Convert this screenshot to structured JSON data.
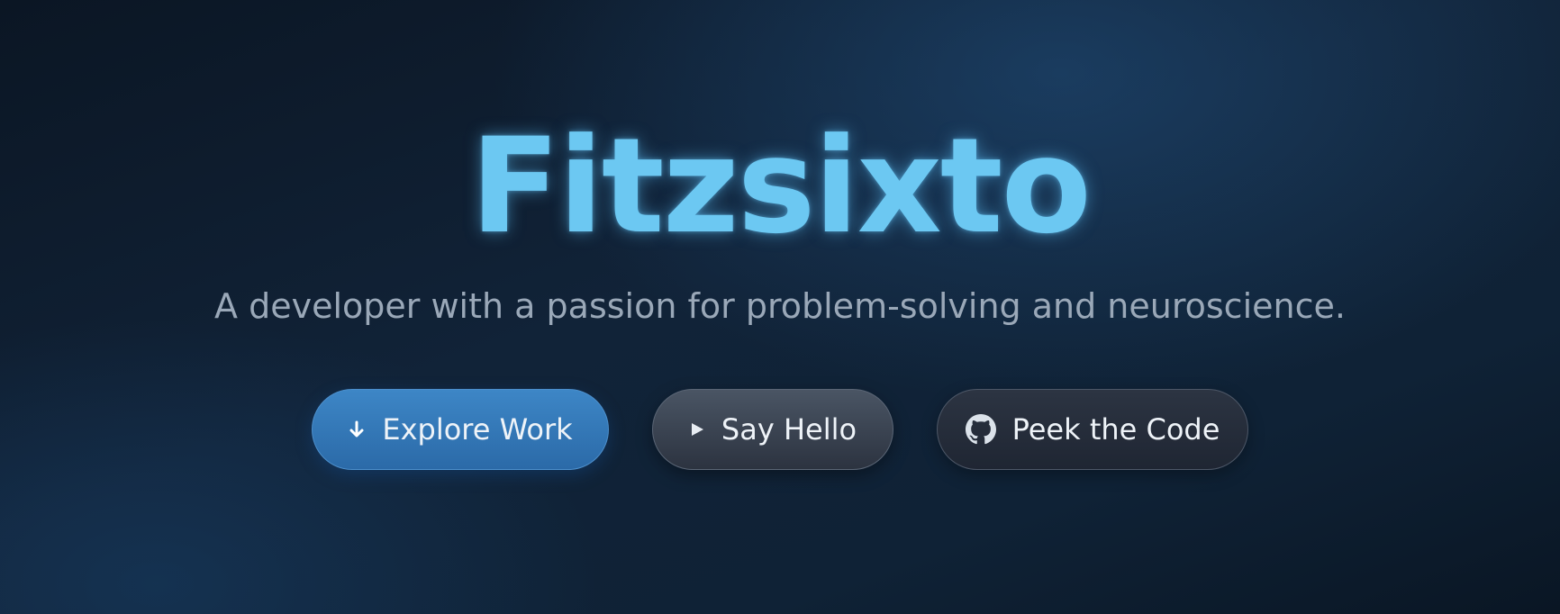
{
  "hero": {
    "title": "Fitzsixto",
    "tagline": "A developer with a passion for problem-solving and neuroscience."
  },
  "actions": [
    {
      "label": "Explore Work",
      "icon": "arrow-down-icon"
    },
    {
      "label": "Say Hello",
      "icon": "play-icon"
    },
    {
      "label": "Peek the Code",
      "icon": "github-icon"
    }
  ],
  "colors": {
    "title": "#6cc8f2",
    "tagline": "#9aa8b8",
    "primary_button": "#3376b8",
    "background": "#0f2236"
  }
}
